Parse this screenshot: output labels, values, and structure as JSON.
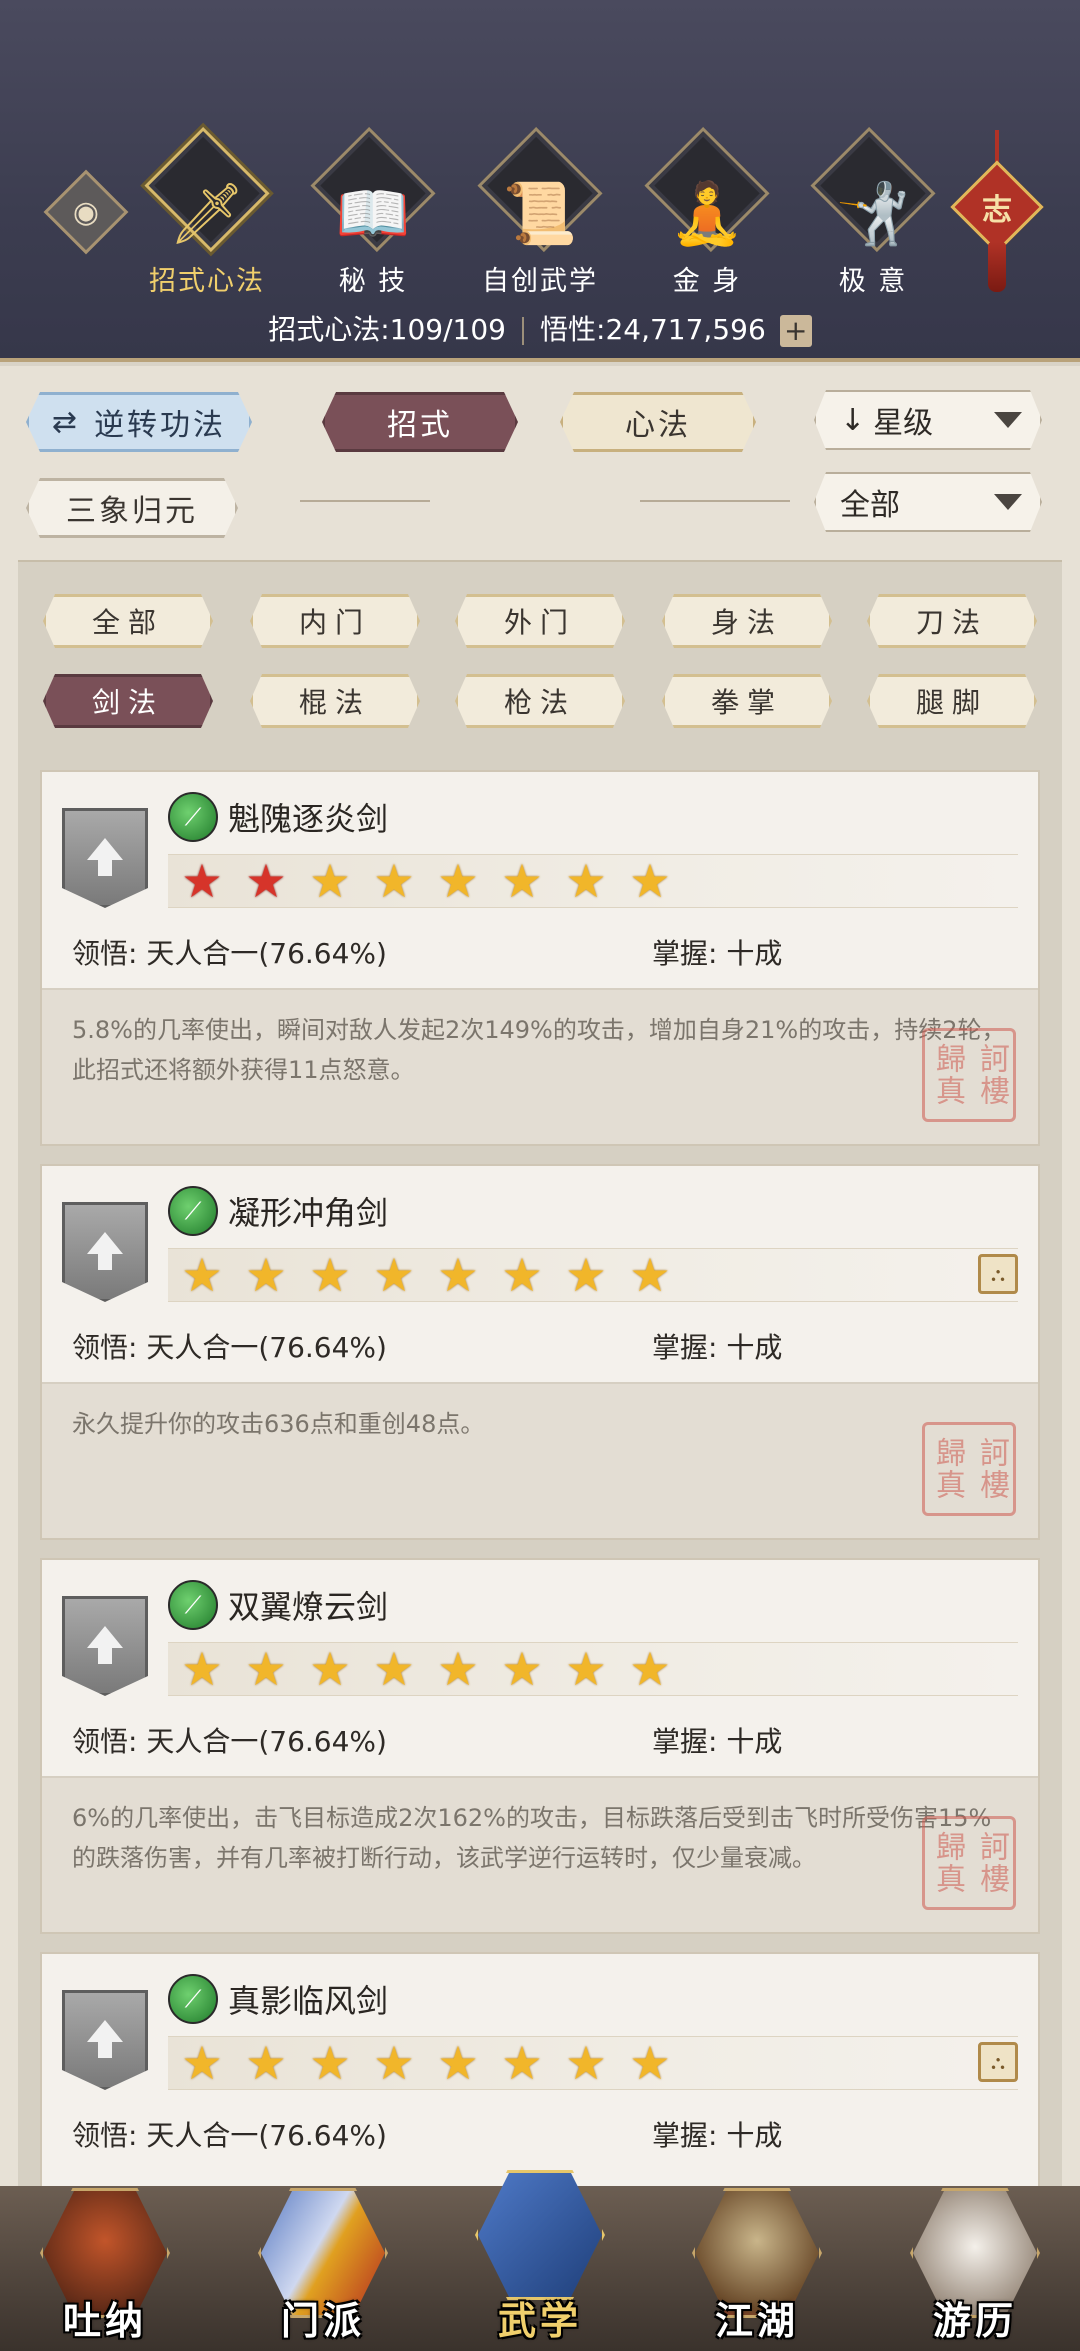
{
  "header": {
    "categories": [
      {
        "label": "招式心法",
        "icon": "sword-icon",
        "active": true
      },
      {
        "label": "秘 技",
        "icon": "book-icon",
        "active": false
      },
      {
        "label": "自创武学",
        "icon": "scroll-icon",
        "active": false
      },
      {
        "label": "金 身",
        "icon": "meditation-icon",
        "active": false
      },
      {
        "label": "极 意",
        "icon": "martial-stance-icon",
        "active": false
      }
    ],
    "zhi_label": "志",
    "stats": {
      "skills_label": "招式心法:",
      "skills_value": "109/109",
      "insight_label": "悟性:",
      "insight_value": "24,717,596",
      "plus": "+"
    }
  },
  "controls": {
    "reverse_button": "逆转功法",
    "tab_moves": "招式",
    "tab_methods": "心法",
    "sort_dropdown": "星级",
    "sanxiang_button": "三象归元",
    "filter_dropdown": "全部"
  },
  "filters": [
    {
      "label": "全部",
      "selected": false
    },
    {
      "label": "内门",
      "selected": false
    },
    {
      "label": "外门",
      "selected": false
    },
    {
      "label": "身法",
      "selected": false
    },
    {
      "label": "刀法",
      "selected": false
    },
    {
      "label": "剑法",
      "selected": true
    },
    {
      "label": "棍法",
      "selected": false
    },
    {
      "label": "枪法",
      "selected": false
    },
    {
      "label": "拳掌",
      "selected": false
    },
    {
      "label": "腿脚",
      "selected": false
    }
  ],
  "skills": [
    {
      "name": "魁隗逐炎剑",
      "stars_red": 2,
      "stars_gold": 6,
      "comprehension_label": "领悟:",
      "comprehension_value": "天人合一(76.64%)",
      "mastery_label": "掌握:",
      "mastery_value": "十成",
      "description": "5.8%的几率使出，瞬间对敌人发起2次149%的攻击，增加自身21%的攻击，持续2轮，此招式还将额外获得11点怒意。",
      "has_scroll": false,
      "seal_text": "訶樓歸真"
    },
    {
      "name": "凝形冲角剑",
      "stars_red": 0,
      "stars_gold": 8,
      "comprehension_label": "领悟:",
      "comprehension_value": "天人合一(76.64%)",
      "mastery_label": "掌握:",
      "mastery_value": "十成",
      "description": "永久提升你的攻击636点和重创48点。",
      "has_scroll": true,
      "seal_text": "訶樓歸真"
    },
    {
      "name": "双翼燎云剑",
      "stars_red": 0,
      "stars_gold": 8,
      "comprehension_label": "领悟:",
      "comprehension_value": "天人合一(76.64%)",
      "mastery_label": "掌握:",
      "mastery_value": "十成",
      "description": "6%的几率使出，击飞目标造成2次162%的攻击，目标跌落后受到击飞时所受伤害15%的跌落伤害，并有几率被打断行动，该武学逆行运转时，仅少量衰减。",
      "has_scroll": false,
      "seal_text": "訶樓歸真"
    },
    {
      "name": "真影临风剑",
      "stars_red": 0,
      "stars_gold": 8,
      "comprehension_label": "领悟:",
      "comprehension_value": "天人合一(76.64%)",
      "mastery_label": "掌握:",
      "mastery_value": "十成",
      "description": "",
      "has_scroll": true,
      "seal_text": ""
    }
  ],
  "bottom_nav": [
    {
      "label": "吐纳",
      "icon": "monk-icon",
      "active": false
    },
    {
      "label": "门派",
      "icon": "sect-banner-icon",
      "active": false
    },
    {
      "label": "武学",
      "icon": "manual-book-icon",
      "active": true
    },
    {
      "label": "江湖",
      "icon": "straw-hat-icon",
      "active": false
    },
    {
      "label": "游历",
      "icon": "horse-icon",
      "active": false
    }
  ],
  "colors": {
    "accent_gold": "#e6c66a",
    "selected_tab": "#7a5058",
    "star_gold": "#f1b62a",
    "star_red": "#d6342a"
  }
}
